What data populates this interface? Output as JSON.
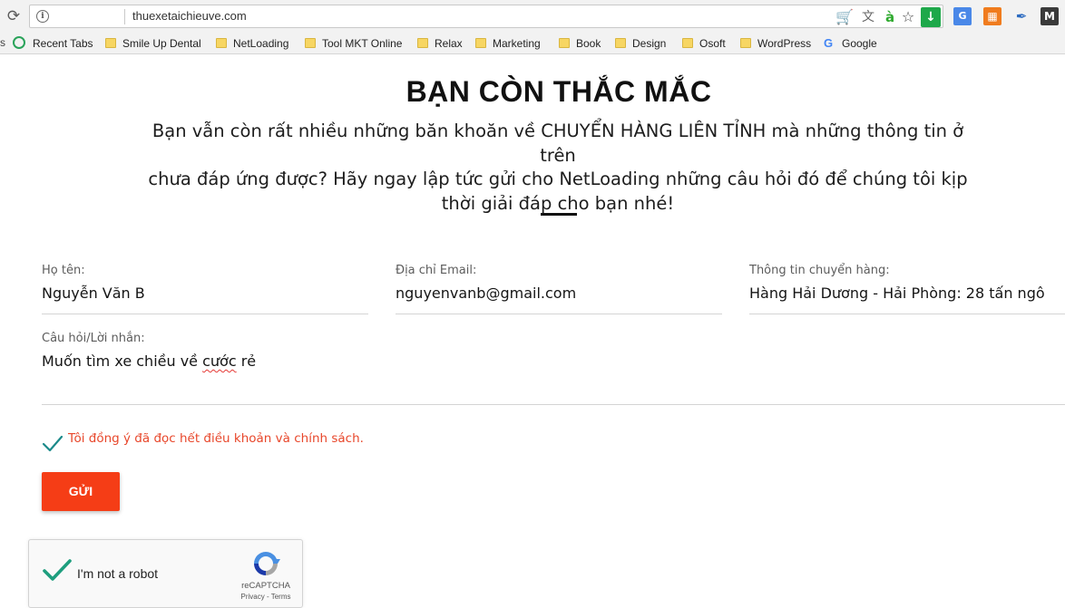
{
  "browser": {
    "url": "thuexetaichieuve.com",
    "info_icon_glyph": "i",
    "reload_glyph": "⟳",
    "extensions": {
      "cart": "🛒",
      "translate": "文",
      "a_glyph": "à",
      "star": "☆",
      "download": "↓",
      "g_translate": "G",
      "orange": "▦",
      "pen": "✒",
      "m": "M"
    },
    "bookmarks_edge": "s",
    "bookmarks": [
      {
        "label": "Recent Tabs",
        "icon": "history-icon"
      },
      {
        "label": "Smile Up Dental",
        "icon": "folder-icon"
      },
      {
        "label": "NetLoading",
        "icon": "folder-icon"
      },
      {
        "label": "Tool MKT Online",
        "icon": "folder-icon"
      },
      {
        "label": "Relax",
        "icon": "folder-icon"
      },
      {
        "label": "Marketing",
        "icon": "folder-icon"
      },
      {
        "label": "Book",
        "icon": "folder-icon"
      },
      {
        "label": "Design",
        "icon": "folder-icon"
      },
      {
        "label": "Osoft",
        "icon": "folder-icon"
      },
      {
        "label": "WordPress",
        "icon": "folder-icon"
      },
      {
        "label": "Google",
        "icon": "google-icon"
      }
    ],
    "google_glyph": "G"
  },
  "page": {
    "heading": "BẠN CÒN THẮC MẮC",
    "intro_line1": "Bạn vẫn còn rất nhiều những băn khoăn về CHUYỂN HÀNG LIÊN TỈNH mà những thông tin ở trên",
    "intro_line2": "chưa đáp ứng được? Hãy ngay lập tức gửi cho NetLoading những câu hỏi đó để chúng tôi kịp",
    "intro_line3": "thời giải đáp cho bạn nhé!"
  },
  "form": {
    "name": {
      "label": "Họ tên:",
      "value": "Nguyễn Văn B"
    },
    "email": {
      "label": "Địa chỉ Email:",
      "value": "nguyenvanb@gmail.com"
    },
    "shipping": {
      "label": "Thông tin chuyển hàng:",
      "value": "Hàng Hải Dương - Hải Phòng: 28 tấn ngô"
    },
    "message": {
      "label": "Câu hỏi/Lời nhắn:",
      "value_part1": "Muốn tìm xe chiều về ",
      "value_misspelled": "cước",
      "value_part2": " rẻ"
    },
    "consent": "Tôi đồng ý đã đọc hết điều khoản và chính sách.",
    "submit_label": "GỬI"
  },
  "recaptcha": {
    "label": "I'm not a robot",
    "brand": "reCAPTCHA",
    "links": "Privacy - Terms",
    "checked": true
  },
  "colors": {
    "accent": "#f53d16",
    "consent_text": "#e8472b",
    "check": "#1b8a8a"
  }
}
